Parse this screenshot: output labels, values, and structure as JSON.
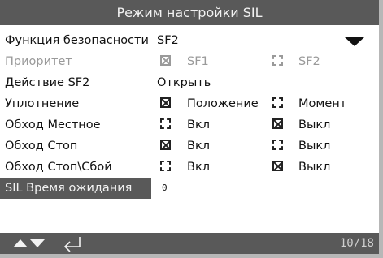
{
  "title": "Режим настройки SIL",
  "rows": [
    {
      "label": "Функция безопасности",
      "value": "SF2"
    },
    {
      "label": "Приоритет",
      "options": [
        "SF1",
        "SF2"
      ]
    },
    {
      "label": "Действие SF2",
      "value": "Открыть"
    },
    {
      "label": "Уплотнение",
      "options": [
        "Положение",
        "Момент"
      ]
    },
    {
      "label": "Обход Местное",
      "options": [
        "Вкл",
        "Выкл"
      ]
    },
    {
      "label": "Обход Стоп",
      "options": [
        "Вкл",
        "Выкл"
      ]
    },
    {
      "label": "Обход Стоп\\Сбой",
      "options": [
        "Вкл",
        "Выкл"
      ]
    },
    {
      "label": "SIL Время ожидания",
      "value": "0"
    }
  ],
  "page": "10/18",
  "colors": {
    "bars": "#595959",
    "bezel": "#b7b7b7",
    "disabled": "#9a9a9a"
  },
  "icons": {
    "dropdown": "dropdown-arrow-icon",
    "nav": "up-down-arrows-icon",
    "enter": "enter-icon"
  }
}
